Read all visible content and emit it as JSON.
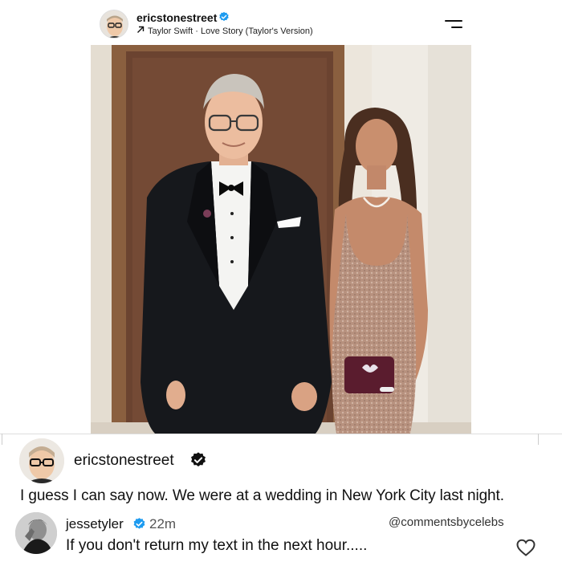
{
  "post": {
    "username": "ericstonestreet",
    "song": "Taylor Swift · Love Story (Taylor's Version)"
  },
  "caption": {
    "username": "ericstonestreet",
    "text": "I guess I can say now. We were at a wedding in New York City last night."
  },
  "comment": {
    "username": "jessetyler",
    "time": "22m",
    "text": "If you don't return my text in the next hour.....",
    "watermark": "@commentsbycelebs"
  },
  "icons": {
    "verified": "verified-badge-icon",
    "arrow": "arrow-up-right-icon",
    "menu": "menu-icon",
    "heart": "heart-icon"
  },
  "colors": {
    "verified_blue": "#1d9bf0",
    "text": "#111111"
  }
}
